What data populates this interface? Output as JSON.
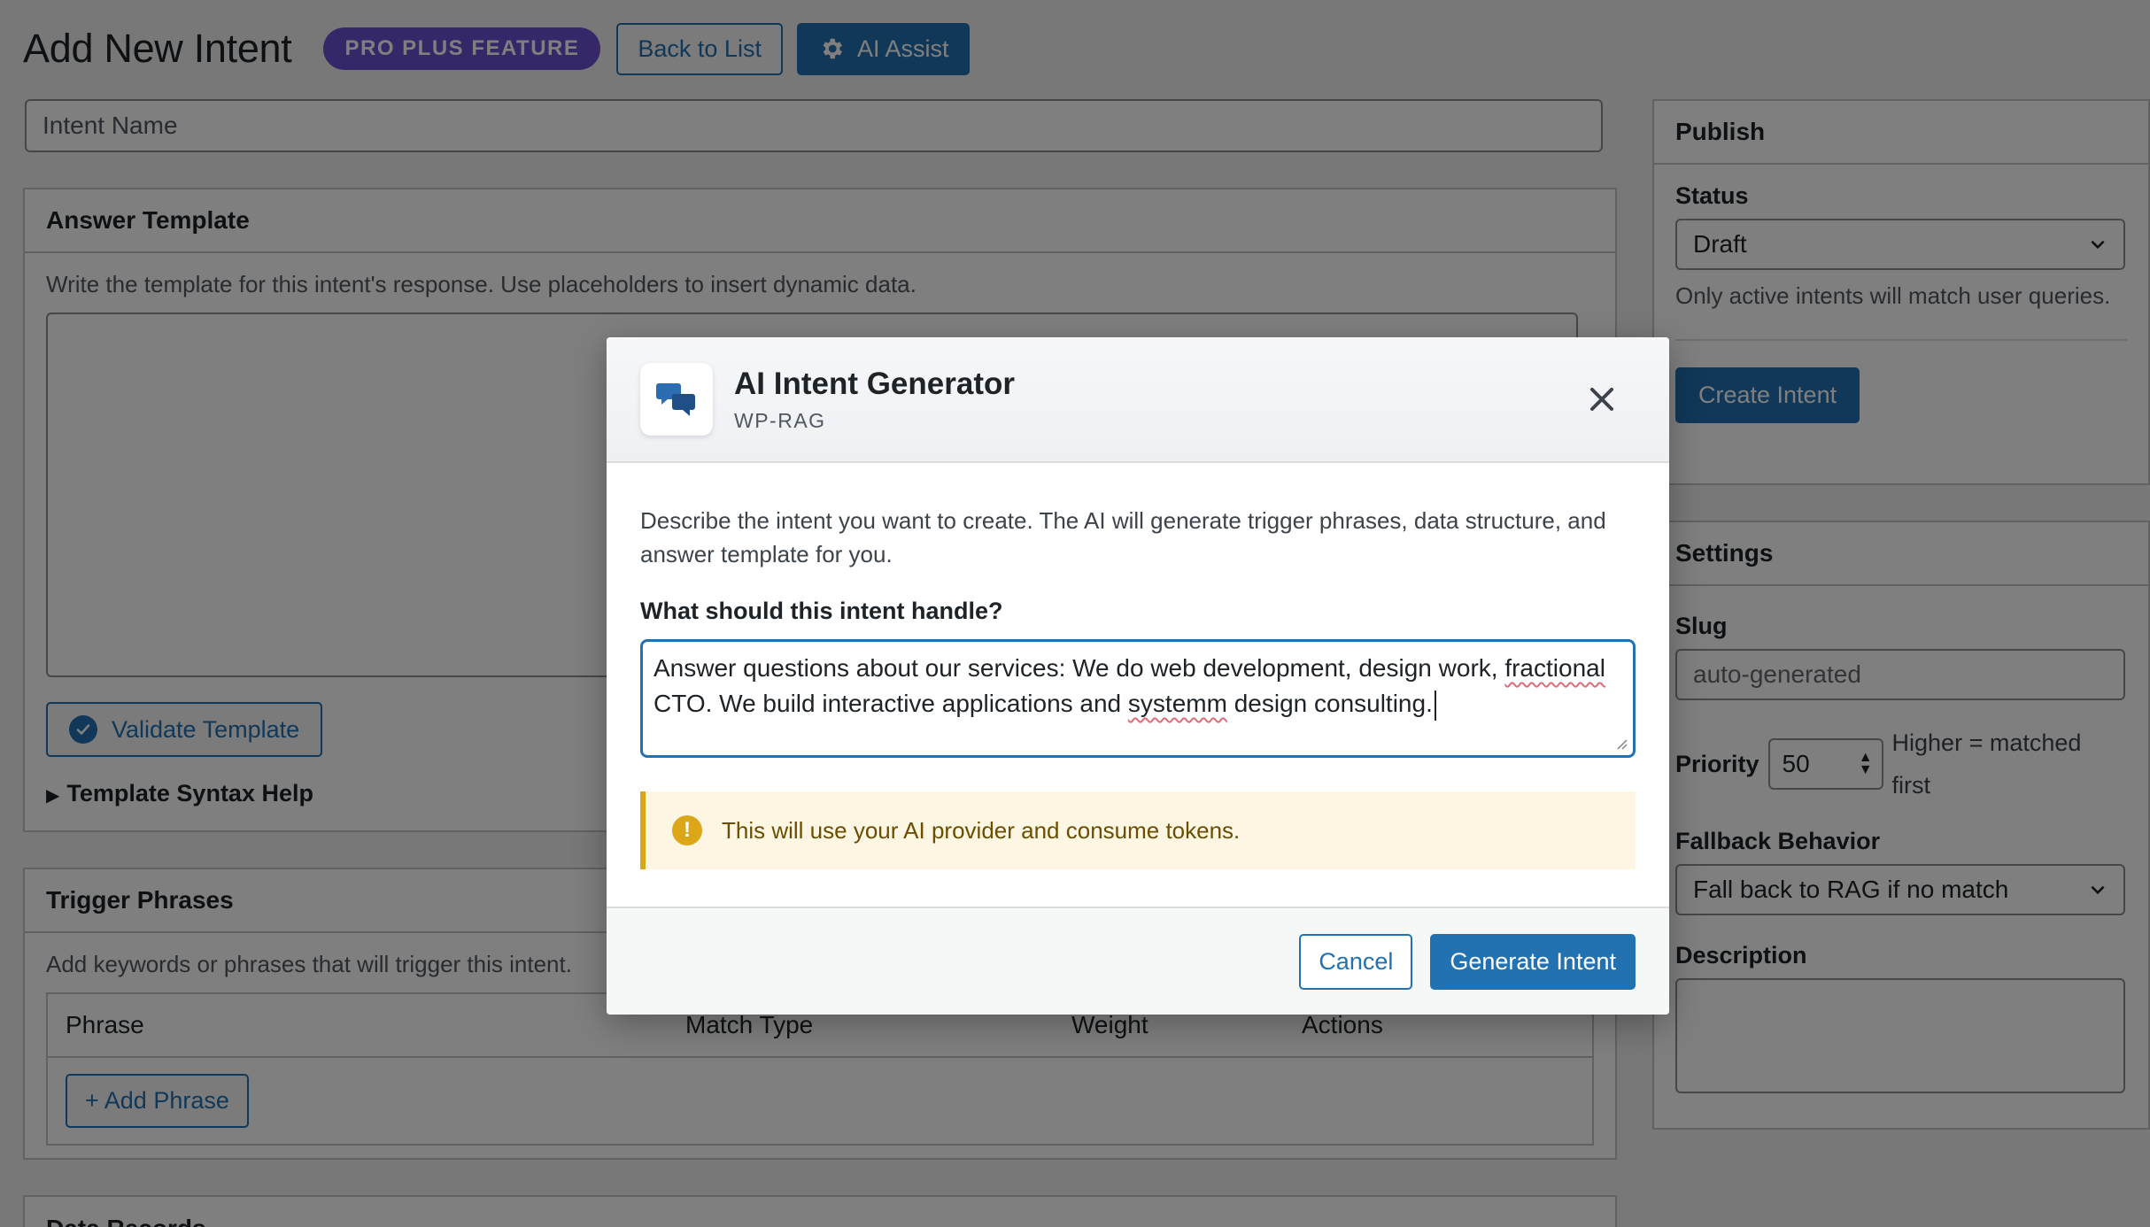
{
  "header": {
    "title": "Add New Intent",
    "badge": "PRO PLUS FEATURE",
    "back_label": "Back to List",
    "ai_assist_label": "AI Assist"
  },
  "intent_name": {
    "placeholder": "Intent Name"
  },
  "answer_template": {
    "heading": "Answer Template",
    "description": "Write the template for this intent's response. Use placeholders to insert dynamic data.",
    "validate_label": "Validate Template",
    "syntax_help_label": "Template Syntax Help"
  },
  "trigger_phrases": {
    "heading": "Trigger Phrases",
    "description": "Add keywords or phrases that will trigger this intent.",
    "columns": [
      "Phrase",
      "Match Type",
      "Weight",
      "Actions"
    ],
    "add_label": "+ Add Phrase"
  },
  "data_records": {
    "heading": "Data Records"
  },
  "publish": {
    "heading": "Publish",
    "status_label": "Status",
    "status_value": "Draft",
    "status_help": "Only active intents will match user queries.",
    "create_label": "Create Intent"
  },
  "settings": {
    "heading": "Settings",
    "slug_label": "Slug",
    "slug_placeholder": "auto-generated",
    "priority_label": "Priority",
    "priority_value": "50",
    "priority_help": "Higher = matched first",
    "fallback_label": "Fallback Behavior",
    "fallback_value": "Fall back to RAG if no match",
    "description_label": "Description"
  },
  "modal": {
    "title": "AI Intent Generator",
    "subtitle": "WP-RAG",
    "description": "Describe the intent you want to create. The AI will generate trigger phrases, data structure, and answer template for you.",
    "field_label": "What should this intent handle?",
    "textarea_parts": {
      "p1": "Answer questions about our services: We do web development, design work, ",
      "w1": "fractional",
      "p2": " CTO. We build interactive applications and ",
      "w2": "systemm",
      "p3": " design consulting."
    },
    "notice": "This will use your AI provider and consume tokens.",
    "cancel_label": "Cancel",
    "generate_label": "Generate Intent"
  },
  "colors": {
    "accent": "#2271b1",
    "badge": "#6b4fd1",
    "warning": "#dba617",
    "overlay": "rgba(0,0,0,0.5)"
  }
}
